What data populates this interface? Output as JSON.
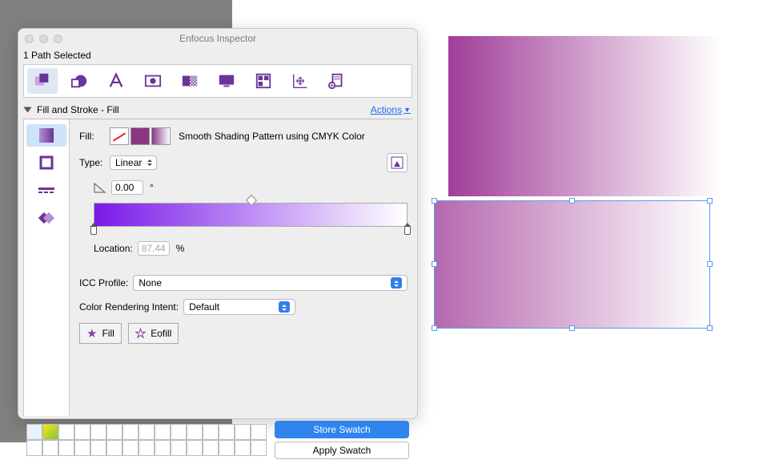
{
  "window": {
    "title": "Enfocus Inspector"
  },
  "status": "1 Path Selected",
  "section": {
    "title": "Fill and Stroke - Fill",
    "actions": "Actions"
  },
  "fill": {
    "label": "Fill:",
    "description": "Smooth Shading Pattern using CMYK Color"
  },
  "type": {
    "label": "Type:",
    "value": "Linear"
  },
  "angle": {
    "value": "0.00",
    "unit": "°"
  },
  "gradient": {
    "thumb_pos_pct": 49,
    "stops": [
      0,
      100
    ]
  },
  "location": {
    "label": "Location:",
    "value": "87.44",
    "unit": "%"
  },
  "icc": {
    "label": "ICC Profile:",
    "value": "None"
  },
  "cri": {
    "label": "Color Rendering Intent:",
    "value": "Default"
  },
  "fillmode": {
    "fill": "Fill",
    "eofill": "Eofill"
  },
  "buttons": {
    "store": "Store Swatch",
    "apply": "Apply Swatch"
  },
  "colors": {
    "accent": "#6a3598",
    "swatch0": "#e6f2ff",
    "swatch1_grad_from": "#f7e617",
    "swatch1_grad_to": "#86c43a"
  }
}
